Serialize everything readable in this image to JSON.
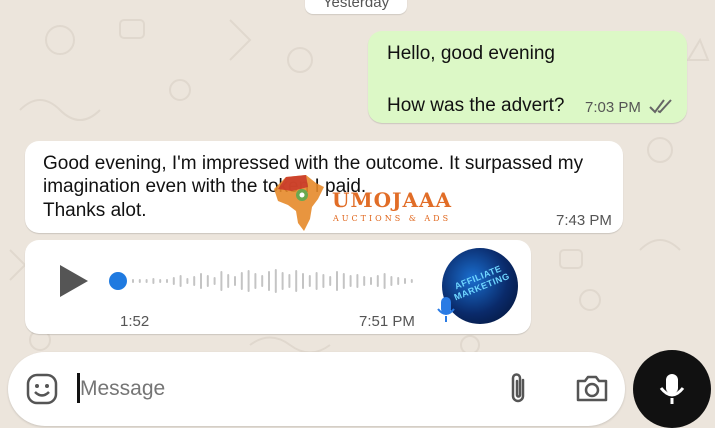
{
  "chat": {
    "date_separator": "Yesterday",
    "outgoing": {
      "line1": "Hello, good evening",
      "line2": "How was the advert?",
      "time": "7:03 PM",
      "status_icon": "double-check-icon"
    },
    "incoming_text": {
      "lines": [
        "Good evening, I'm impressed with the outcome. It surpassed my",
        "imagination even with the token I paid.",
        "Thanks alot."
      ],
      "time": "7:43 PM"
    },
    "incoming_voice": {
      "duration": "1:52",
      "time": "7:51 PM",
      "progress": 0,
      "avatar_text": "AFFILIATE MARKETING"
    }
  },
  "watermark": {
    "title": "UMOJAAA",
    "subtitle": "AUCTIONS & ADS"
  },
  "composer": {
    "placeholder": "Message",
    "icons": [
      "emoji-icon",
      "attach-icon",
      "camera-icon",
      "mic-icon"
    ]
  },
  "colors": {
    "outgoing_bubble": "#dcf8c6",
    "incoming_bubble": "#ffffff",
    "background": "#ece5dc",
    "voice_accent": "#1f7ae0",
    "mic_button": "#111111"
  }
}
